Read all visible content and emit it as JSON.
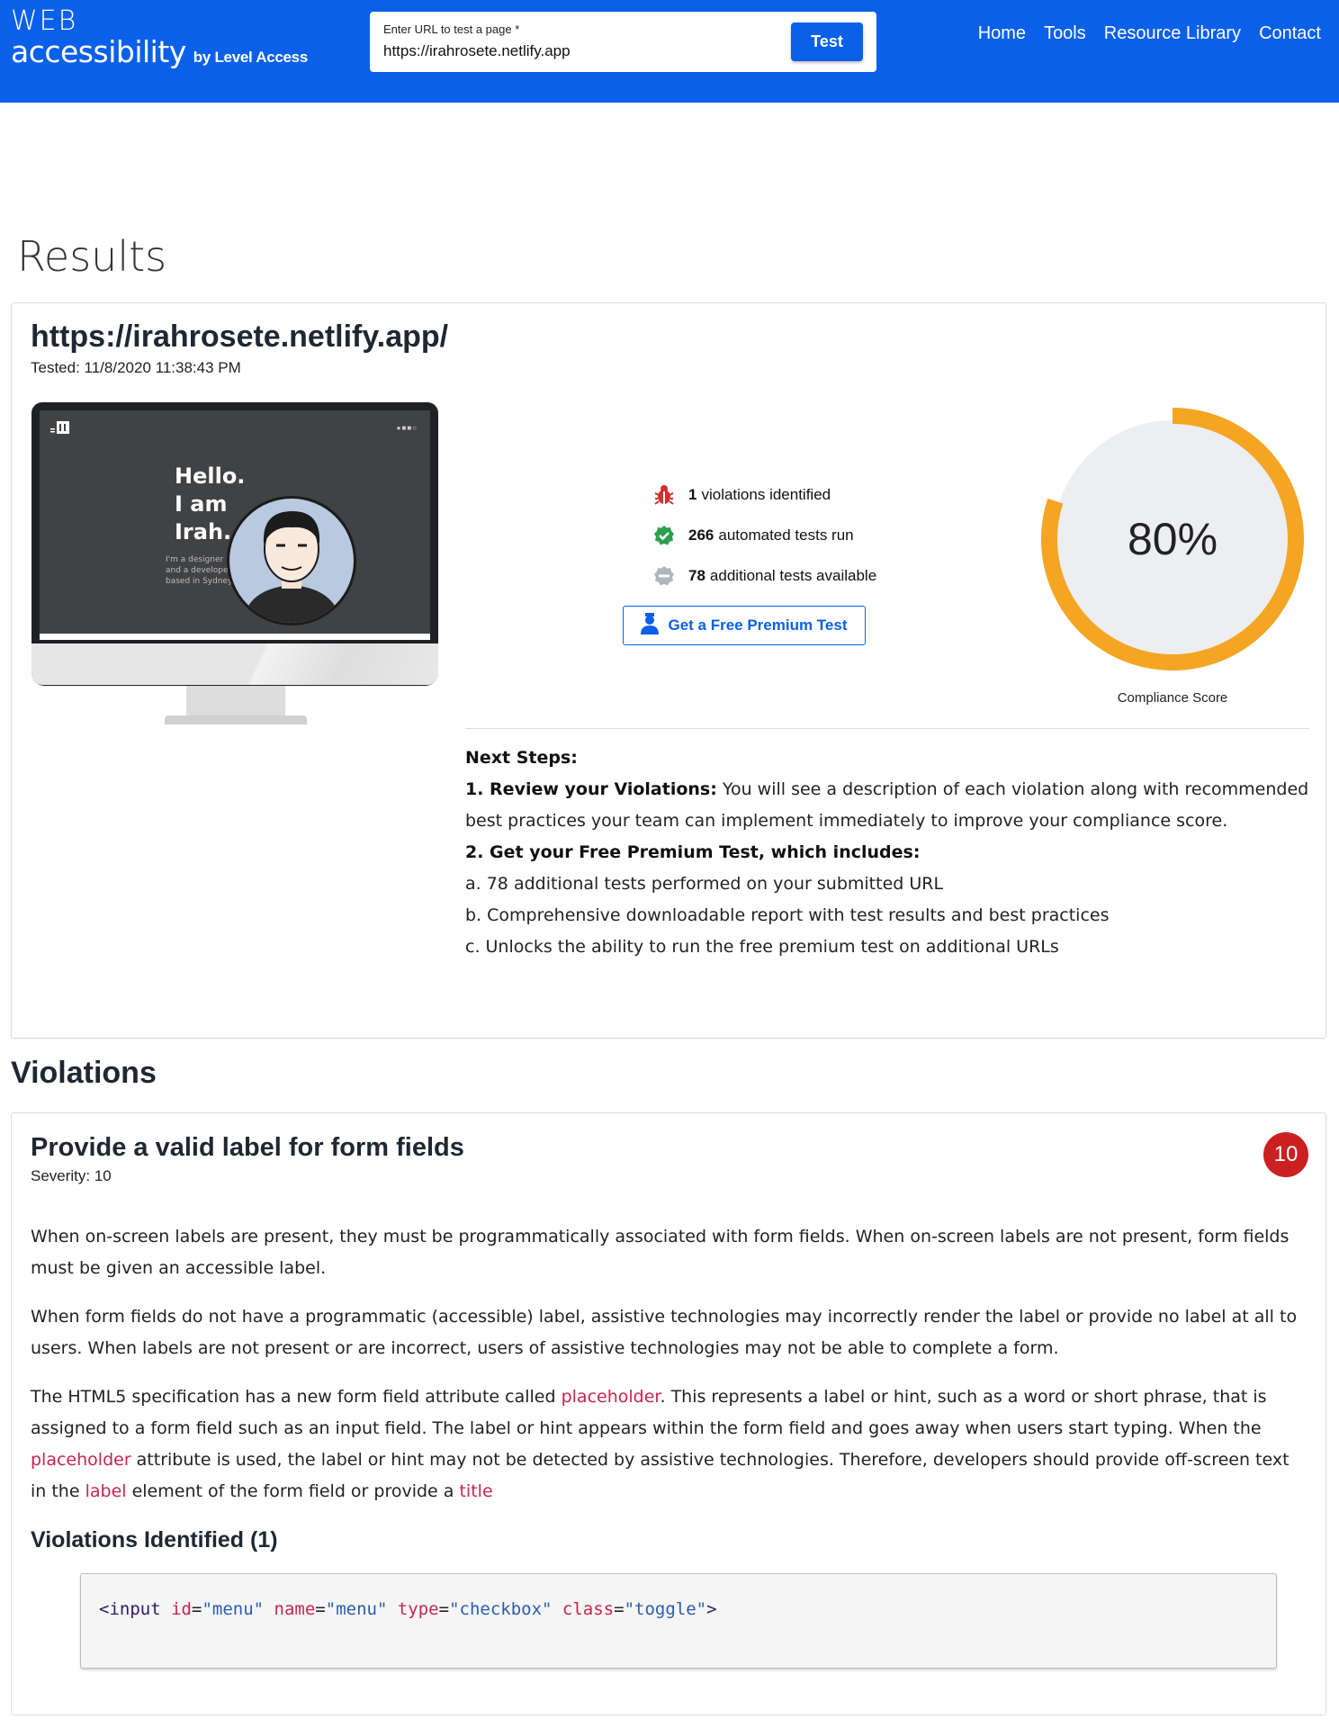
{
  "header": {
    "logo_web": "WEB",
    "logo_accessibility": "accessibility",
    "logo_by": "by Level Access",
    "url_label": "Enter URL to test a page *",
    "url_value": "https://irahrosete.netlify.app",
    "test_button": "Test",
    "nav": [
      "Home",
      "Tools",
      "Resource Library",
      "Contact"
    ],
    "brand_color": "#0b60ea"
  },
  "results": {
    "title": "Results",
    "site_url": "https://irahrosete.netlify.app/",
    "tested": "Tested: 11/8/2020 11:38:43 PM",
    "preview": {
      "hello": [
        "Hello.",
        "I am",
        "Irah."
      ],
      "sub": [
        "I'm a designer",
        "and a developer",
        "based in Sydney."
      ]
    },
    "stats": [
      {
        "count": "1",
        "label": "violations identified",
        "icon": "bug-icon",
        "color": "#d32f2f"
      },
      {
        "count": "266",
        "label": "automated tests run",
        "icon": "check-badge-icon",
        "color": "#2e9e4f"
      },
      {
        "count": "78",
        "label": "additional tests available",
        "icon": "minus-badge-icon",
        "color": "#b0b6bd"
      }
    ],
    "premium_button": "Get a Free Premium Test",
    "score": {
      "value": 80,
      "display": "80%",
      "label": "Compliance Score",
      "color": "#f5a524",
      "track": "#eceef1"
    },
    "next_steps": {
      "heading": "Next Steps:",
      "step1_bold": "1. Review your Violations:",
      "step1_text": " You will see a description of each violation along with recommended best practices your team can implement immediately to improve your compliance score.",
      "step2_bold": "2. Get your Free Premium Test, which includes:",
      "items": [
        "a. 78 additional tests performed on your submitted URL",
        "b. Comprehensive downloadable report with test results and best practices",
        "c. Unlocks the ability to run the free premium test on additional URLs"
      ]
    }
  },
  "violations": {
    "title": "Violations",
    "item": {
      "title": "Provide a valid label for form fields",
      "severity": "Severity: 10",
      "badge": "10",
      "para1": "When on-screen labels are present, they must be programmatically associated with form fields. When on-screen labels are not present, form fields must be given an accessible label.",
      "para2": "When form fields do not have a programmatic (accessible) label, assistive technologies may incorrectly render the label or provide no label at all to users. When labels are not present or are incorrect, users of assistive technologies may not be able to complete a form.",
      "para3": {
        "t1": "The HTML5 specification has a new form field attribute called ",
        "c1": "placeholder",
        "t2": ". This represents a label or hint, such as a word or short phrase, that is assigned to a form field such as an input field. The label or hint appears within the form field and goes away when users start typing. When the ",
        "c2": "placeholder",
        "t3": " attribute is used, the label or hint may not be detected by assistive technologies. Therefore, developers should provide off-screen text in the ",
        "c3": "label",
        "t4": " element of the form field or provide a ",
        "c4": "title"
      },
      "identified_title": "Violations Identified (1)",
      "code": {
        "open": "<input",
        "attrs": [
          {
            "name": "id",
            "value": "\"menu\""
          },
          {
            "name": "name",
            "value": "\"menu\""
          },
          {
            "name": "type",
            "value": "\"checkbox\""
          },
          {
            "name": "class",
            "value": "\"toggle\""
          }
        ],
        "close": ">"
      }
    }
  }
}
